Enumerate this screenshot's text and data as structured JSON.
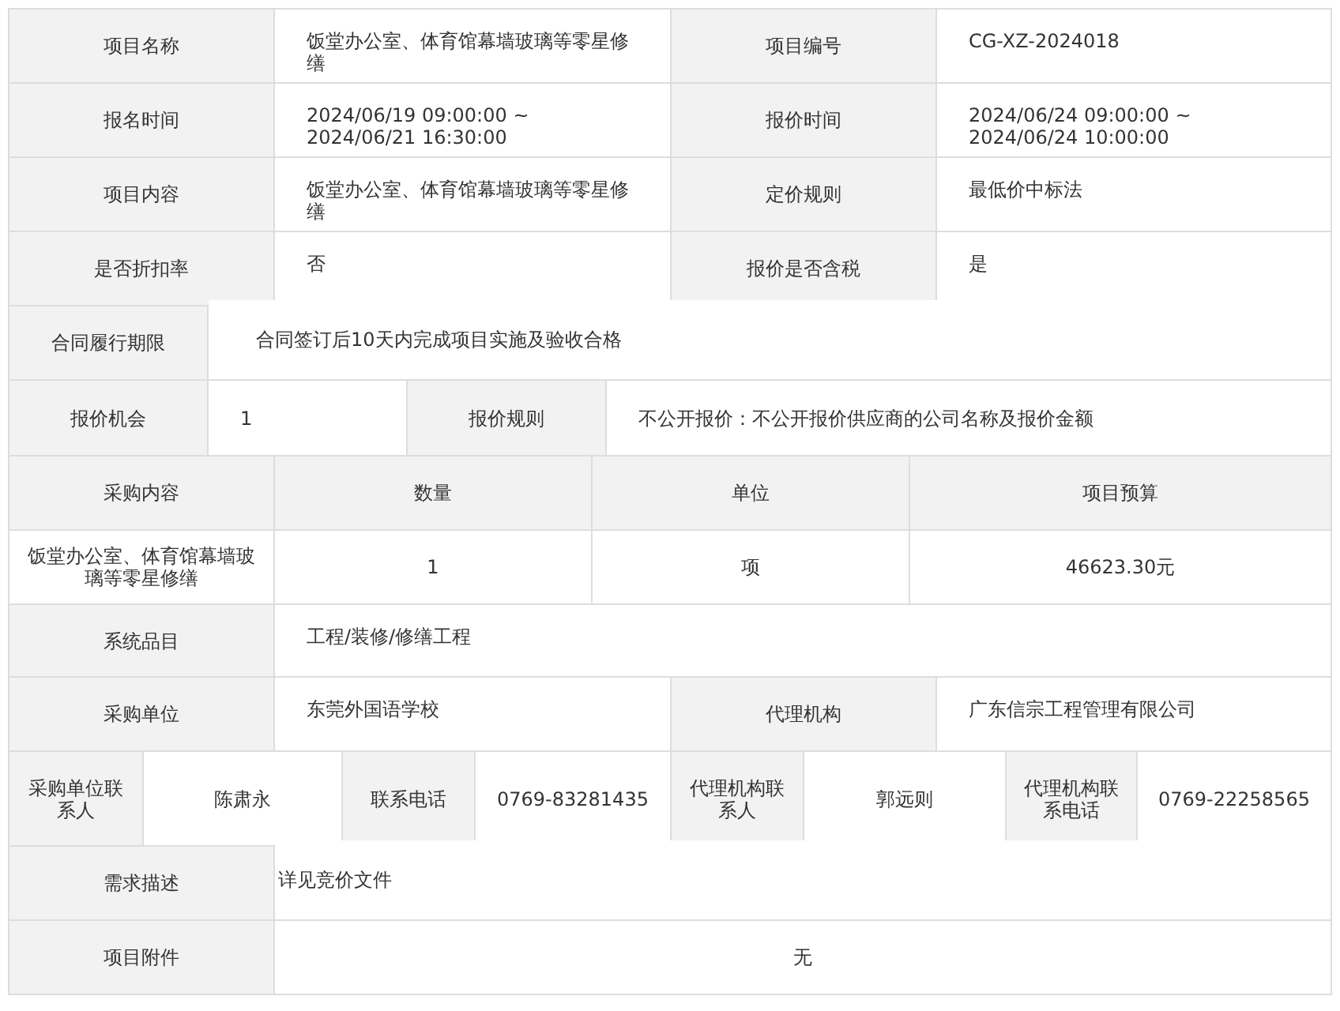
{
  "rows": [
    {
      "kind": "four_col",
      "cells": [
        "项目名称",
        "饭堂办公室、体育馆幕墙玻璃等零星修缮",
        "项目编号",
        "CG-XZ-2024018"
      ]
    },
    {
      "kind": "four_col",
      "cells": [
        "报名时间",
        "2024/06/19 09:00:00 ~ 2024/06/21 16:30:00",
        "报价时间",
        "2024/06/24 09:00:00 ~ 2024/06/24 10:00:00"
      ]
    },
    {
      "kind": "four_col",
      "cells": [
        "项目内容",
        "饭堂办公室、体育馆幕墙玻璃等零星修缮",
        "定价规则",
        "最低价中标法"
      ]
    },
    {
      "kind": "four_col",
      "cells": [
        "是否折扣率",
        "否",
        "报价是否含税",
        "是"
      ]
    },
    {
      "kind": "wide_two",
      "cells": [
        "合同履行期限",
        "合同签订后10天内完成项目实施及验收合格"
      ]
    },
    {
      "kind": "narrow_four",
      "cells": [
        "报价机会",
        "1",
        "报价规则",
        "不公开报价：不公开报价供应商的公司名称及报价金额"
      ]
    },
    {
      "kind": "items_header",
      "cells": [
        "采购内容",
        "数量",
        "单位",
        "项目预算"
      ]
    },
    {
      "kind": "items_row",
      "cells": [
        "饭堂办公室、体育馆幕墙玻璃等零星修缮",
        "1",
        "项",
        "46623.30元"
      ]
    },
    {
      "kind": "two_col",
      "cells": [
        "系统品目",
        "工程/装修/修缮工程"
      ]
    },
    {
      "kind": "four_col",
      "cells": [
        "采购单位",
        "东莞外国语学校",
        "代理机构",
        "广东信宗工程管理有限公司"
      ]
    },
    {
      "kind": "contacts",
      "cells": [
        "采购单位联系人",
        "陈肃永",
        "联系电话",
        "0769-83281435",
        "代理机构联系人",
        "郭远则",
        "代理机构联系电话",
        "0769-22258565"
      ]
    },
    {
      "kind": "desc",
      "cells": [
        "需求描述",
        "详见竞价文件"
      ]
    },
    {
      "kind": "attachment",
      "cells": [
        "项目附件",
        "无"
      ]
    }
  ]
}
